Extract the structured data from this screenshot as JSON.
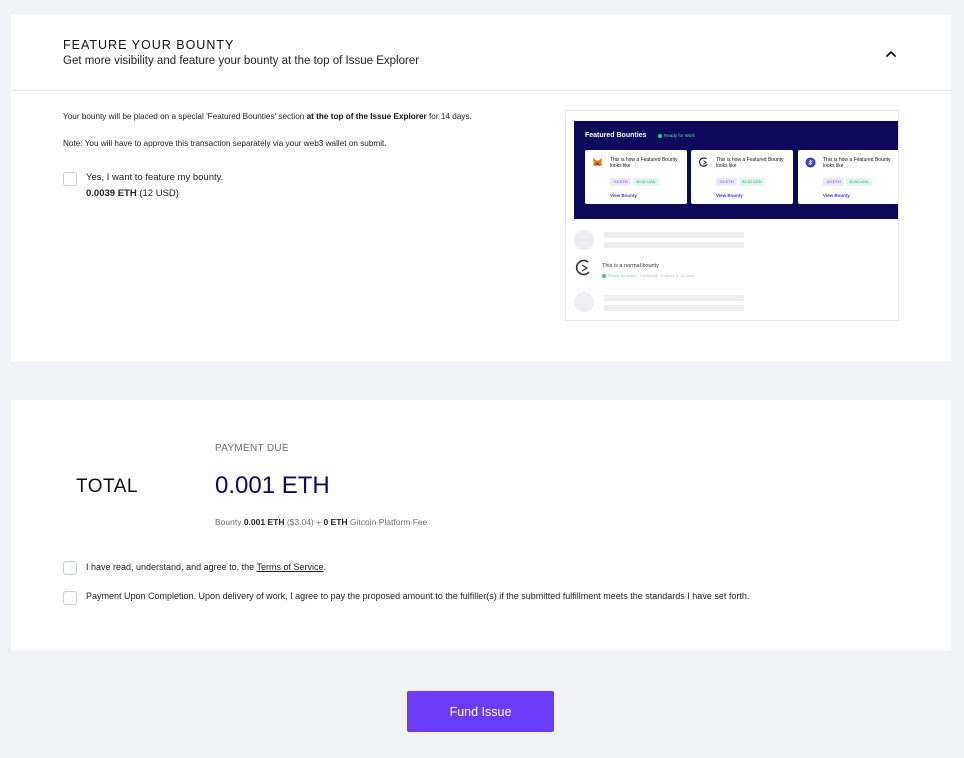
{
  "feature": {
    "title": "FEATURE YOUR BOUNTY",
    "subtitle": "Get more visibility and feature your bounty at the top of Issue Explorer",
    "desc_prefix": "Your bounty will be placed on a special 'Featured Bounties' section ",
    "desc_bold": "at the top of the Issue Explorer",
    "desc_suffix": " for 14 days.",
    "note": "Note: You will have to approve this transaction separately via your web3 wallet on submit.",
    "checkbox_label": "Yes, I want to feature my bounty.",
    "price_eth": "0.0039 ETH",
    "price_usd": " (12 USD)",
    "checked": false
  },
  "preview": {
    "title": "Featured Bounties",
    "ready": "Ready for Work",
    "cards": [
      {
        "text": "This is how a Featured Bounty looks like",
        "eth": ".03 ETH",
        "usd": "30.82 USD",
        "link": "View Bounty",
        "icon": "metamask-icon"
      },
      {
        "text": "This is how a Featured Bounty looks like",
        "eth": ".03 ETH",
        "usd": "30.82 USD",
        "link": "View Bounty",
        "icon": "gitcoin-icon"
      },
      {
        "text": "This is how a Featured Bounty looks like",
        "eth": ".03 ETH",
        "usd": "30.82 USD",
        "link": "View Bounty",
        "icon": "ethereum-icon"
      }
    ],
    "normal_title": "This is a normal bounty",
    "normal_ready": "Ready for Work",
    "normal_type": "Traditional",
    "normal_expires": "Expires in 12 days"
  },
  "total": {
    "payment_label": "PAYMENT DUE",
    "label": "TOTAL",
    "amount": "0.001 ETH",
    "bounty_label": "Bounty ",
    "bounty_eth": "0.001 ETH",
    "bounty_usd": " ($3.04) + ",
    "fee_eth": "0 ETH",
    "fee_label": " Gitcoin Platform Fee",
    "tos_prefix": "I have read, understand, and agree to, the ",
    "tos_link": "Terms of Service",
    "tos_suffix": ".",
    "puc_label": "Payment Upon Completion. Upon delivery of work, I agree to pay the proposed amount to the fulfiller(s) if the submitted fulfillment meets the standards I have set forth."
  },
  "actions": {
    "fund_label": "Fund Issue"
  },
  "colors": {
    "accent": "#6a3cf7",
    "navy": "#0d0a5c",
    "background": "#f0f2f6"
  }
}
